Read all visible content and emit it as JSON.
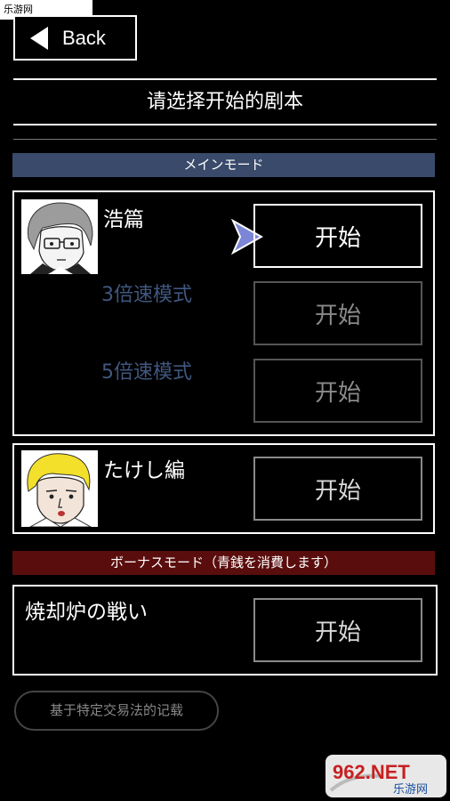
{
  "watermark": {
    "site_text": "乐游网 www.962.net",
    "logo_main": "962.NET",
    "logo_sub": "乐游网"
  },
  "nav": {
    "back_label": "Back"
  },
  "header": {
    "title": "请选择开始的剧本"
  },
  "main_mode": {
    "section_label": "メインモード",
    "chapters": [
      {
        "name": "浩篇",
        "start_label": "开始",
        "modes": [
          {
            "name": "3倍速模式",
            "start_label": "开始"
          },
          {
            "name": "5倍速模式",
            "start_label": "开始"
          }
        ]
      },
      {
        "name": "たけし編",
        "start_label": "开始"
      }
    ]
  },
  "bonus_mode": {
    "section_label": "ボーナスモード（青銭を消費します）",
    "chapters": [
      {
        "name": "焼却炉の戦い",
        "start_label": "开始"
      }
    ]
  },
  "footer": {
    "record_label": "基于特定交易法的记载"
  },
  "colors": {
    "main_section_bg": "#3a4a6b",
    "bonus_section_bg": "#5a0d0d",
    "locked_mode_text": "#40577f",
    "cursor_fill": "#7b86d6"
  }
}
